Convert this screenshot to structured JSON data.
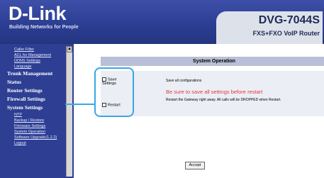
{
  "brand": {
    "logo": "D-Link",
    "tagline": "Building Networks for People",
    "model": "DVG-7044S",
    "model_sub": "FXS+FXO VoIP Router"
  },
  "sidebar": {
    "items": [
      {
        "label": "Caller Filter",
        "type": "sub"
      },
      {
        "label": "ACL for Management",
        "type": "sub"
      },
      {
        "label": "DDNS Settings",
        "type": "sub"
      },
      {
        "label": "Language",
        "type": "sub"
      },
      {
        "label": "Trunk Management",
        "type": "main"
      },
      {
        "label": "Status",
        "type": "main"
      },
      {
        "label": "Router Settings",
        "type": "main"
      },
      {
        "label": "Firewall Settings",
        "type": "main"
      },
      {
        "label": "System Settings",
        "type": "main"
      },
      {
        "label": "NTP",
        "type": "sub"
      },
      {
        "label": "Backup / Restore",
        "type": "sub"
      },
      {
        "label": "Firmware Settings",
        "type": "sub"
      },
      {
        "label": "System Operation",
        "type": "sub"
      },
      {
        "label": "Software Upgrade(1.2.2)",
        "type": "sub"
      },
      {
        "label": "Logout",
        "type": "sub"
      }
    ]
  },
  "main": {
    "title": "System Operation",
    "save_settings": {
      "label_line1": "Save",
      "label_line2": "Settings",
      "description": "Save all configurations"
    },
    "warning": "Be sure to save all settings before restart",
    "restart": {
      "label": "Restart",
      "description": "Restart the Gateway right away. All calls will be DROPPED when Restart."
    },
    "accept_label": "Accept"
  },
  "colors": {
    "header": "#2b3d92",
    "sidebar": "#2d3e93",
    "panel_title": "#b9bfd6",
    "panel": "#eceef6",
    "warning": "#e03a3a",
    "highlight": "#3aa7e4"
  }
}
